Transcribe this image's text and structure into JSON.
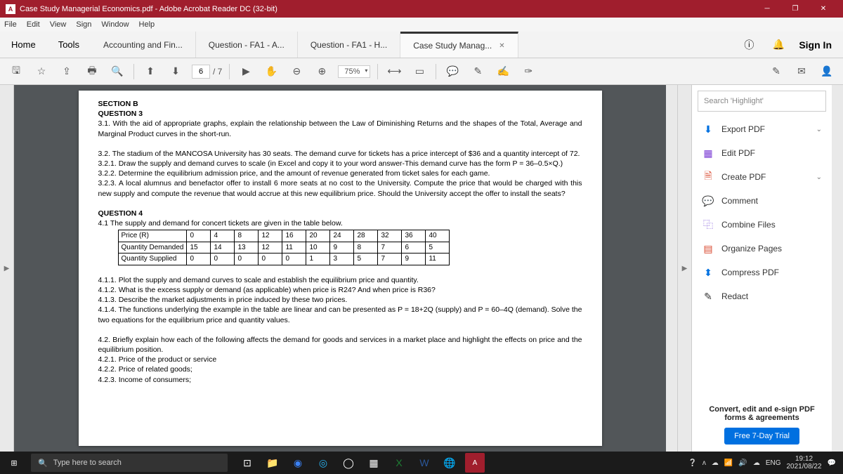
{
  "title": "Case Study Managerial Economics.pdf - Adobe Acrobat Reader DC (32-bit)",
  "menu": [
    "File",
    "Edit",
    "View",
    "Sign",
    "Window",
    "Help"
  ],
  "nav": {
    "home": "Home",
    "tools": "Tools"
  },
  "tabs": [
    {
      "label": "Accounting and Fin..."
    },
    {
      "label": "Question - FA1 - A..."
    },
    {
      "label": "Question - FA1 - H..."
    },
    {
      "label": "Case Study Manag...",
      "active": true
    }
  ],
  "sign_in": "Sign In",
  "toolbar": {
    "page": "6",
    "pages": "/ 7",
    "zoom": "75%"
  },
  "panel": {
    "search_placeholder": "Search 'Highlight'",
    "items": [
      {
        "label": "Export PDF",
        "color": "#0070e0",
        "chev": true
      },
      {
        "label": "Edit PDF",
        "color": "#7a3bd4"
      },
      {
        "label": "Create PDF",
        "color": "#d8452b",
        "chev": true
      },
      {
        "label": "Comment",
        "color": "#e0a500"
      },
      {
        "label": "Combine Files",
        "color": "#6a3bd4"
      },
      {
        "label": "Organize Pages",
        "color": "#d8452b"
      },
      {
        "label": "Compress PDF",
        "color": "#0070e0"
      },
      {
        "label": "Redact",
        "color": "#333"
      }
    ],
    "promo": "Convert, edit and e-sign PDF forms & agreements",
    "trial": "Free 7-Day Trial"
  },
  "doc": {
    "section": "SECTION B",
    "q3": "QUESTION 3",
    "q3_1": "3.1.  With the aid of appropriate graphs, explain the relationship between the Law of Diminishing Returns and the shapes of the Total, Average and Marginal Product curves in the short-run.",
    "q3_2": "3.2.   The stadium of the MANCOSA University has 30 seats. The demand curve for tickets has a price intercept of $36 and a quantity intercept of 72.",
    "q3_2_1": "3.2.1.   Draw the supply and demand curves to scale (in Excel and copy it to your word answer-This demand curve has the form P = 36–0.5×Q.)",
    "q3_2_2": "3.2.2.   Determine the equilibrium admission price, and the amount of revenue generated from ticket sales for each game.",
    "q3_2_3": "3.2.3.   A local alumnus and benefactor offer to install 6 more seats at no cost to the University. Compute the price that would be charged with this new supply and compute the revenue that would accrue at this new equilibrium price. Should the University accept the offer to install the seats?",
    "q4": "QUESTION 4",
    "q4_1": "4.1      The supply and demand for concert tickets are given in the table below.",
    "q4_1_1": "4.1.1.   Plot the supply and demand curves to scale and establish the equilibrium price and quantity.",
    "q4_1_2": "4.1.2.   What is the excess supply or demand (as applicable) when price is R24? And when price is R36?",
    "q4_1_3": "4.1.3.   Describe the market adjustments in price induced by these two prices.",
    "q4_1_4": "4.1.4.   The functions underlying the example in the table are linear and can be presented as P = 18+2Q (supply) and P = 60–4Q (demand). Solve the two equations for the equilibrium price and quantity values.",
    "q4_2": "4.2.  Briefly explain how each of the following affects the demand for goods and services in a market place and highlight the effects on price and the equilibrium position.",
    "q4_2_1": "4.2.1.   Price of the product or service",
    "q4_2_2": "4.2.2.   Price of related goods;",
    "q4_2_3": "4.2.3.   Income of consumers;"
  },
  "table": {
    "r1": [
      "Price (R)",
      "0",
      "4",
      "8",
      "12",
      "16",
      "20",
      "24",
      "28",
      "32",
      "36",
      "40"
    ],
    "r2": [
      "Quantity Demanded",
      "15",
      "14",
      "13",
      "12",
      "11",
      "10",
      "9",
      "8",
      "7",
      "6",
      "5"
    ],
    "r3": [
      "Quantity Supplied",
      "0",
      "0",
      "0",
      "0",
      "0",
      "1",
      "3",
      "5",
      "7",
      "9",
      "11"
    ]
  },
  "taskbar": {
    "search": "Type here to search",
    "lang": "ENG",
    "time": "19:12",
    "date": "2021/08/22"
  }
}
